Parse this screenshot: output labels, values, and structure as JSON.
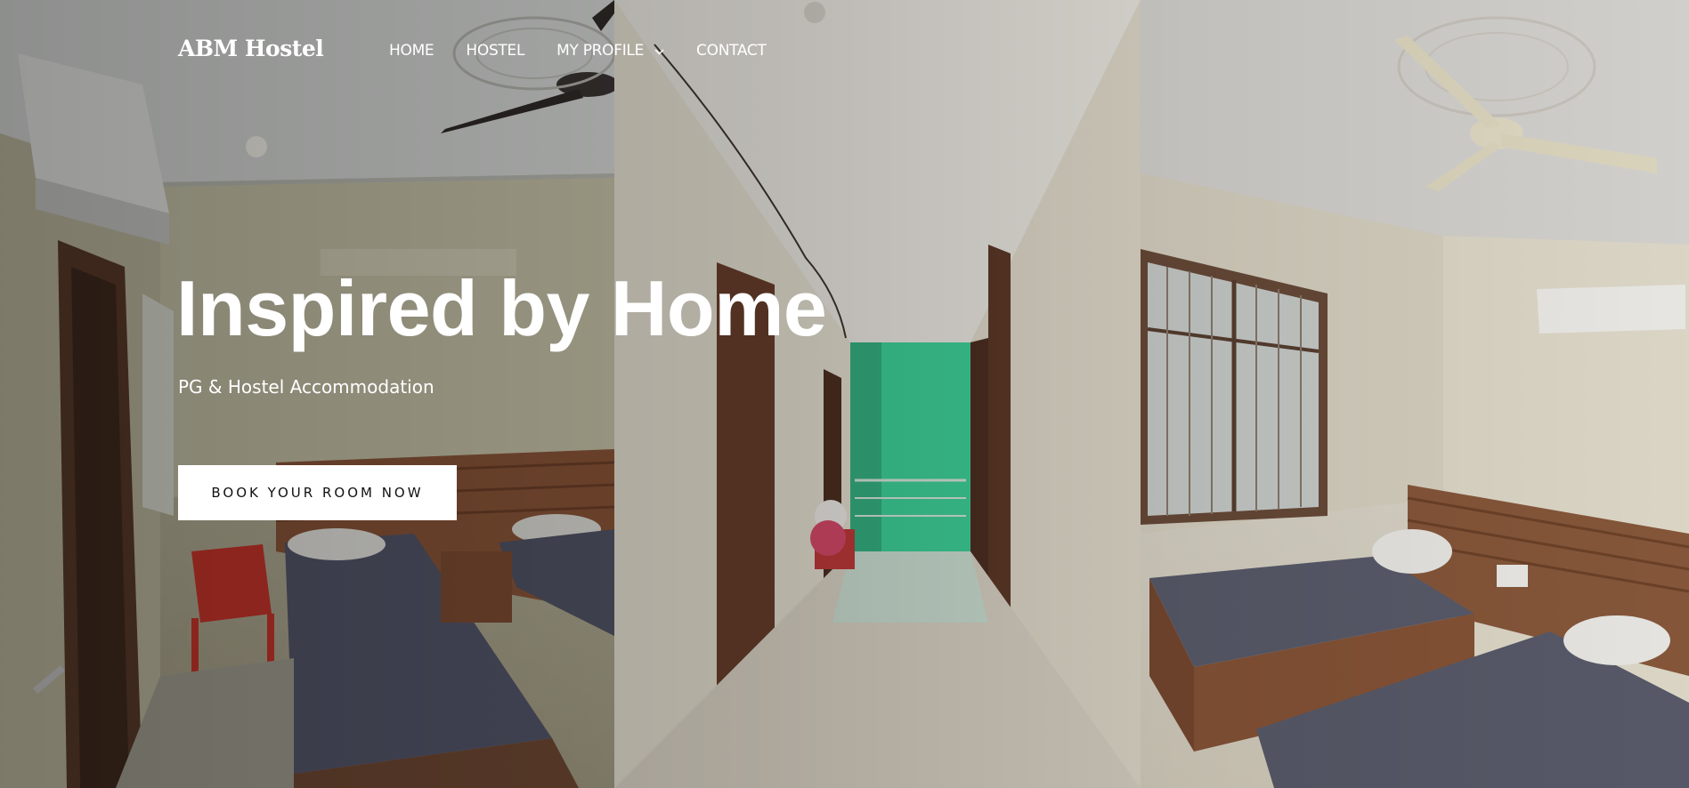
{
  "header": {
    "logo": "ABM Hostel",
    "nav": [
      {
        "label": "HOME"
      },
      {
        "label": "HOSTEL"
      },
      {
        "label": "MY PROFILE"
      },
      {
        "label": "CONTACT"
      }
    ]
  },
  "hero": {
    "title": "Inspired by Home",
    "subtitle": "PG & Hostel Accommodation",
    "cta_label": "BOOK YOUR ROOM NOW"
  },
  "colors": {
    "text": "#ffffff",
    "button_bg": "#ffffff",
    "button_text": "#111111",
    "corridor_accent": "#3fd49a"
  },
  "icons": [
    "chevron-down-icon"
  ],
  "images": [
    "room-photo-left",
    "corridor-photo-center",
    "room-photo-right"
  ]
}
